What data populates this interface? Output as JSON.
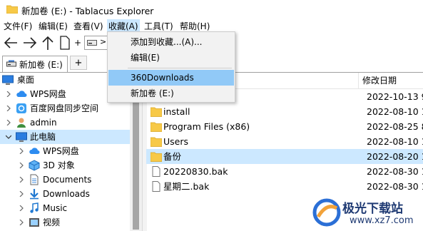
{
  "window": {
    "title": "新加卷 (E:) - Tablacus Explorer"
  },
  "menu": [
    {
      "label": "文件(F)"
    },
    {
      "label": "编辑(E)"
    },
    {
      "label": "查看(V)"
    },
    {
      "label": "收藏(A)"
    },
    {
      "label": "工具(T)"
    },
    {
      "label": "帮助(H)"
    }
  ],
  "toolbar": {
    "plus_label": "+",
    "arrow_label": ">"
  },
  "tabs": [
    {
      "label": "新加卷 (E:)"
    }
  ],
  "tab_add_label": "+",
  "tree": [
    {
      "label": "桌面",
      "icon": "desktop-icon",
      "expanded": null,
      "level": 0
    },
    {
      "label": "WPS网盘",
      "icon": "cloud-icon",
      "expanded": false,
      "level": 1
    },
    {
      "label": "百度网盘同步空间",
      "icon": "baidu-icon",
      "expanded": false,
      "level": 1
    },
    {
      "label": "admin",
      "icon": "user-icon",
      "expanded": false,
      "level": 1
    },
    {
      "label": "此电脑",
      "icon": "computer-icon",
      "expanded": true,
      "level": 1,
      "selected": true
    },
    {
      "label": "WPS网盘",
      "icon": "cloud-icon",
      "expanded": false,
      "level": 2
    },
    {
      "label": "3D 对象",
      "icon": "cube-icon",
      "expanded": false,
      "level": 2
    },
    {
      "label": "Documents",
      "icon": "documents-icon",
      "expanded": false,
      "level": 2
    },
    {
      "label": "Downloads",
      "icon": "download-icon",
      "expanded": false,
      "level": 2
    },
    {
      "label": "Music",
      "icon": "music-icon",
      "expanded": false,
      "level": 2
    },
    {
      "label": "视频",
      "icon": "video-icon",
      "expanded": false,
      "level": 2
    }
  ],
  "filelist": {
    "header_modified": "修改日期",
    "rows": [
      {
        "name": "",
        "date": "2022-10-13 9:",
        "type": "folder"
      },
      {
        "name": "install",
        "date": "2022-08-10 1",
        "type": "folder"
      },
      {
        "name": "Program Files (x86)",
        "date": "2022-08-25 8:",
        "type": "folder"
      },
      {
        "name": "Users",
        "date": "2022-08-10 1",
        "type": "folder"
      },
      {
        "name": "备份",
        "date": "2022-08-20 1",
        "type": "folder",
        "selected": true
      },
      {
        "name": "20220830.bak",
        "date": "2022-08-30 1",
        "type": "file"
      },
      {
        "name": "星期二.bak",
        "date": "2022-08-30 1",
        "type": "file"
      }
    ]
  },
  "dropdown": {
    "items": [
      {
        "label": "添加到收藏...(A)..."
      },
      {
        "label": "编辑(E)"
      },
      {
        "label": "360Downloads",
        "highlighted": true
      },
      {
        "label": "新加卷 (E:)"
      }
    ]
  },
  "watermark": {
    "text": "极光下载站",
    "url": "www.xz7.com"
  },
  "colors": {
    "selection": "#cce8ff",
    "menu_highlight": "#91c9f7",
    "folder": "#f7c948"
  }
}
